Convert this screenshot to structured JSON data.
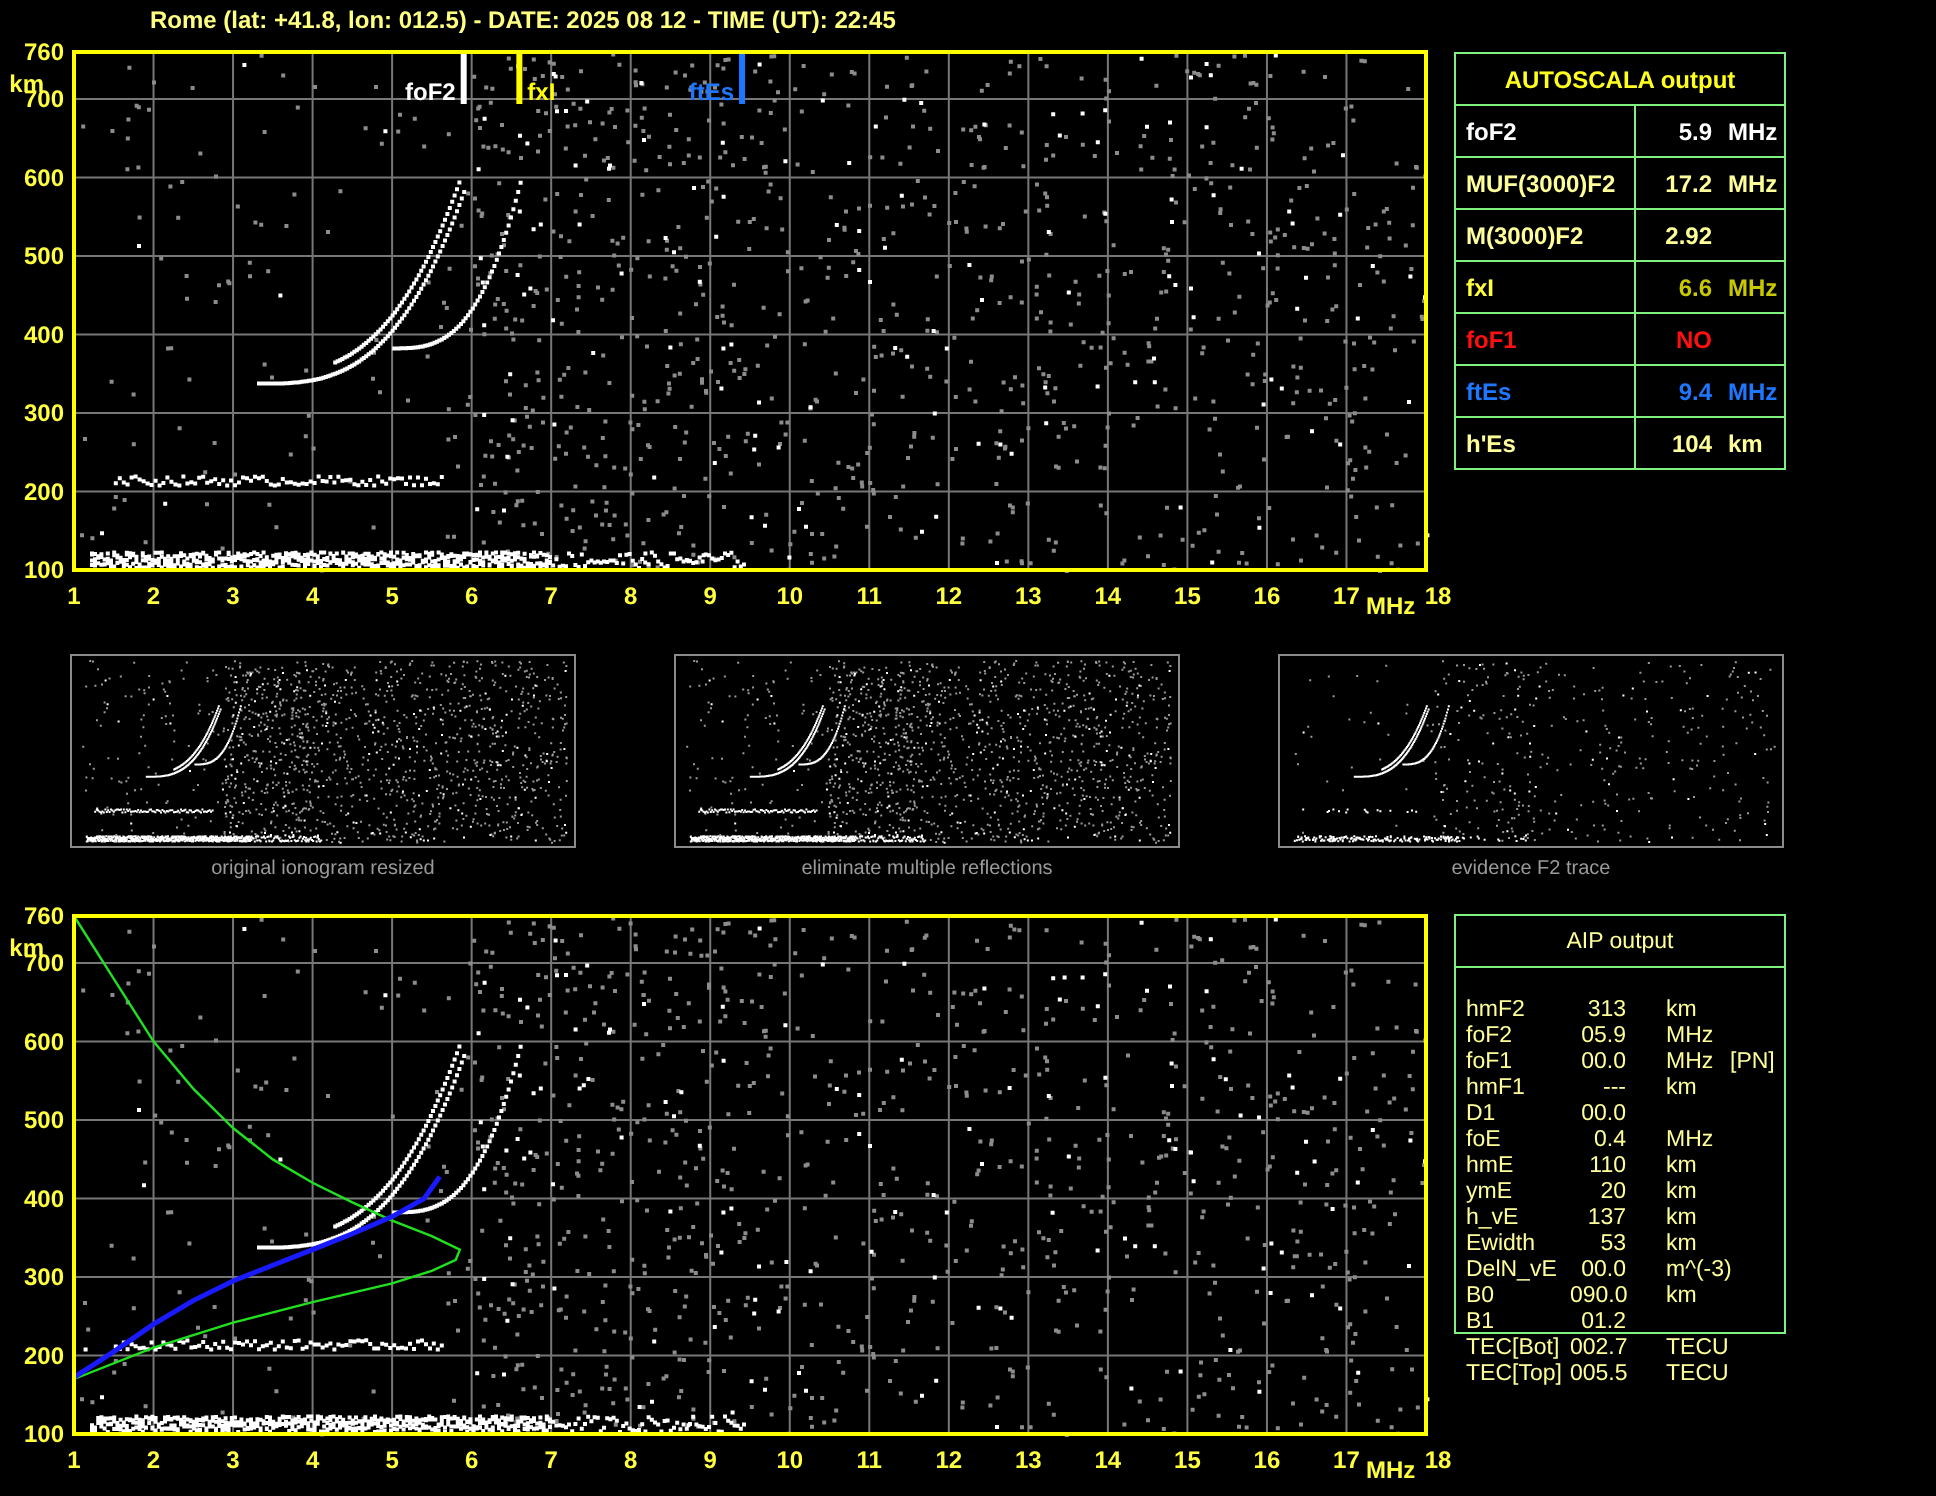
{
  "header": {
    "title": "Rome (lat: +41.8, lon: 012.5) - DATE: 2025 08 12 - TIME (UT): 22:45"
  },
  "top_ionogram": {
    "y_ticks": [
      "760",
      "700",
      "600",
      "500",
      "400",
      "300",
      "200",
      "100"
    ],
    "y_unit": "km",
    "x_ticks": [
      "1",
      "2",
      "3",
      "4",
      "5",
      "6",
      "7",
      "8",
      "9",
      "10",
      "11",
      "12",
      "13",
      "14",
      "15",
      "16",
      "17",
      "18"
    ],
    "x_unit": "MHz",
    "markers": [
      {
        "label": "foF2",
        "color": "#ffffff"
      },
      {
        "label": "fxI",
        "color": "#ffff00"
      },
      {
        "label": "ftEs",
        "color": "#1e78ff"
      }
    ]
  },
  "autoscala": {
    "title": "AUTOSCALA output",
    "rows": [
      {
        "label": {
          "text": "foF2",
          "color": "#ffffff"
        },
        "value": {
          "text": "5.9",
          "unit": "MHz",
          "color": "#ffffff"
        }
      },
      {
        "label": {
          "text": "MUF(3000)F2",
          "color": "#ffff99"
        },
        "value": {
          "text": "17.2",
          "unit": "MHz",
          "color": "#ffff99"
        }
      },
      {
        "label": {
          "text": "M(3000)F2",
          "color": "#ffff99"
        },
        "value": {
          "text": "2.92",
          "color": "#ffff99"
        }
      },
      {
        "label": {
          "text": "fxI",
          "color": "#ffff40"
        },
        "value": {
          "text": "6.6",
          "unit": "MHz",
          "color": "#c8c800"
        }
      },
      {
        "label": {
          "text": "foF1",
          "color": "#ff1010"
        },
        "value": {
          "text": "NO",
          "color": "#ff1010"
        }
      },
      {
        "label": {
          "text": "ftEs",
          "color": "#1e78ff"
        },
        "value": {
          "text": "9.4",
          "unit": "MHz",
          "color": "#1e78ff"
        }
      },
      {
        "label": {
          "text": "h'Es",
          "color": "#ffff99"
        },
        "value": {
          "text": "104",
          "unit": "km",
          "color": "#ffff99"
        }
      }
    ]
  },
  "thumbnails": [
    {
      "caption": "original ionogram resized"
    },
    {
      "caption": "eliminate multiple reflections"
    },
    {
      "caption": "evidence F2 trace"
    }
  ],
  "bottom_ionogram": {
    "y_ticks": [
      "760",
      "700",
      "600",
      "500",
      "400",
      "300",
      "200",
      "100"
    ],
    "y_unit": "km",
    "x_ticks": [
      "1",
      "2",
      "3",
      "4",
      "5",
      "6",
      "7",
      "8",
      "9",
      "10",
      "11",
      "12",
      "13",
      "14",
      "15",
      "16",
      "17",
      "18"
    ],
    "x_unit": "MHz"
  },
  "aip": {
    "title": "AIP output",
    "rows": [
      {
        "name": "hmF2",
        "value": "313",
        "unit": "km"
      },
      {
        "name": "foF2",
        "value": "05.9",
        "unit": "MHz"
      },
      {
        "name": "foF1",
        "value": "00.0",
        "unit": "MHz",
        "note": "[PN]"
      },
      {
        "name": "hmF1",
        "value": "---",
        "unit": "km"
      },
      {
        "name": "D1",
        "value": "00.0"
      },
      {
        "name": "foE",
        "value": "0.4",
        "unit": "MHz"
      },
      {
        "name": "hmE",
        "value": "110",
        "unit": "km"
      },
      {
        "name": "ymE",
        "value": "20",
        "unit": "km"
      },
      {
        "name": "h_vE",
        "value": "137",
        "unit": "km"
      },
      {
        "name": "Ewidth",
        "value": "53",
        "unit": "km"
      },
      {
        "name": "DelN_vE",
        "value": "00.0",
        "unit": "m^(-3)"
      },
      {
        "name": "B0",
        "value": "090.0",
        "unit": "km"
      },
      {
        "name": "B1",
        "value": "01.2"
      },
      {
        "name": "TEC[Bot]",
        "value": "002.7",
        "unit": "TECU"
      },
      {
        "name": "TEC[Top]",
        "value": "005.5",
        "unit": "TECU"
      }
    ]
  }
}
